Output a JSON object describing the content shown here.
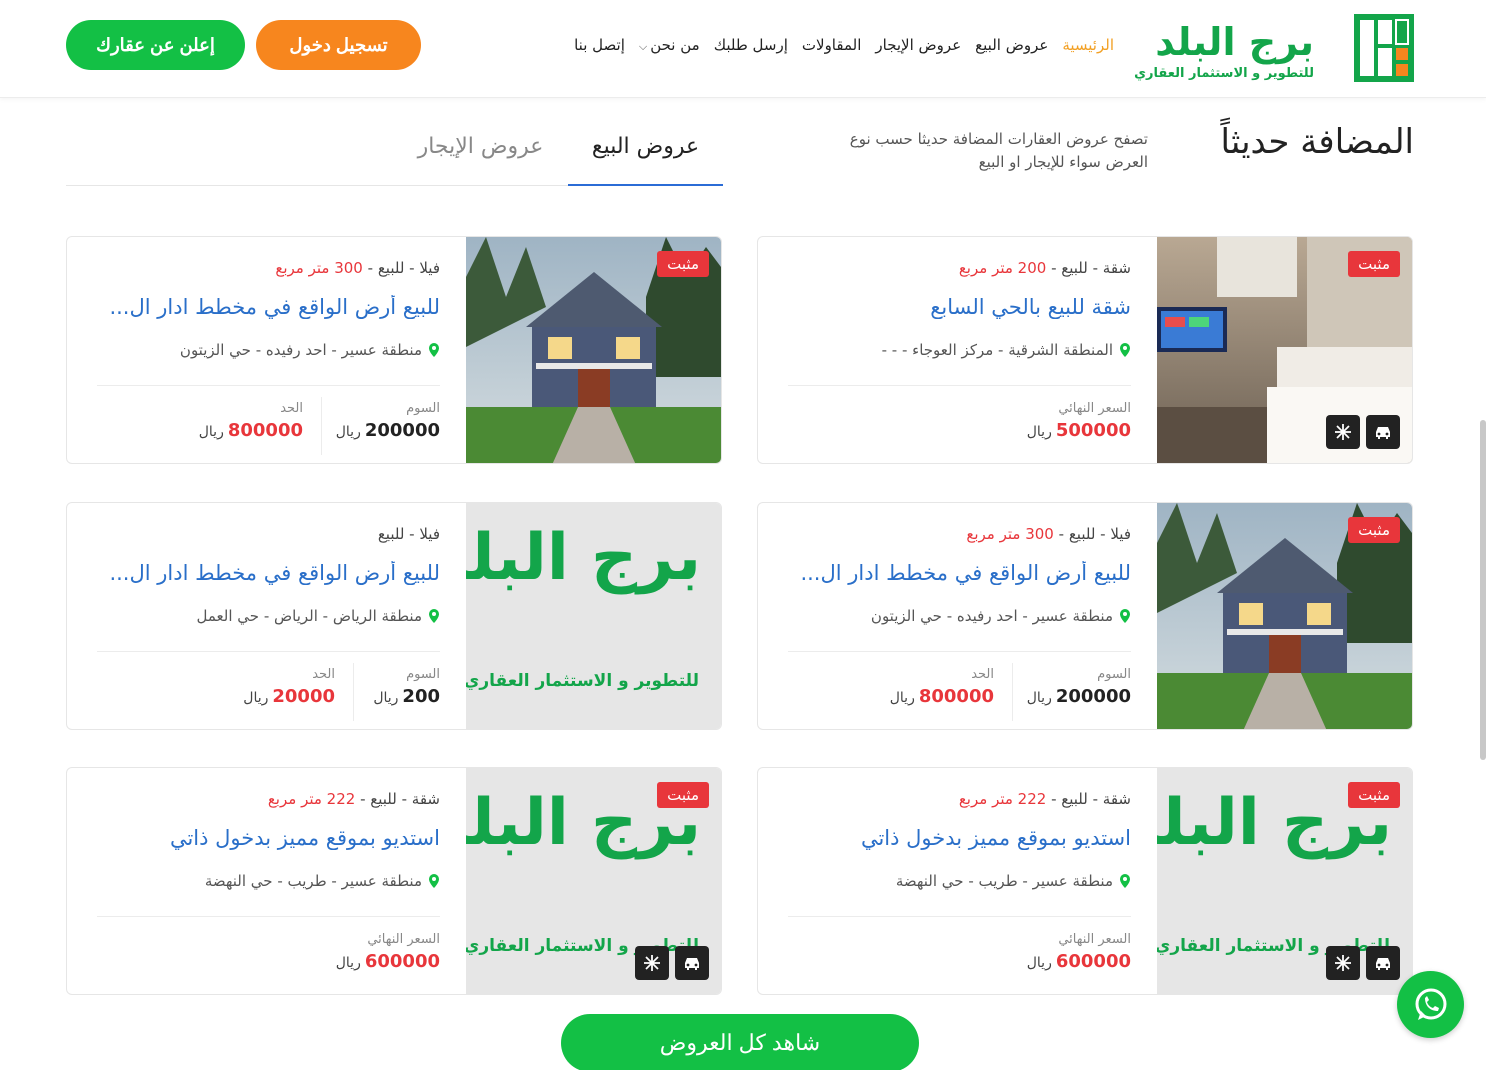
{
  "brand": {
    "name": "برج البلد",
    "tagline": "للتطوير و الاستثمار العقاري",
    "green": "#13a54a",
    "orange": "#f7861e"
  },
  "nav": {
    "items": [
      {
        "label": "الرئيسية",
        "active": true
      },
      {
        "label": "عروض البيع"
      },
      {
        "label": "عروض الإيجار"
      },
      {
        "label": "المقاولات"
      },
      {
        "label": "إرسل طلبك"
      },
      {
        "label": "من نحن"
      },
      {
        "label": "إتصل بنا"
      }
    ],
    "login": "تسجيل دخول",
    "advertise": "إعلن عن عقارك"
  },
  "section": {
    "title": "المضافة حديثاً",
    "description": "تصفح عروض العقارات المضافة حديثا حسب نوع العرض سواء للإيجار او البيع",
    "tabs": {
      "sale": "عروض البيع",
      "rent": "عروض الإيجار"
    }
  },
  "labels": {
    "verified": "مثبت",
    "final_price": "السعر النهائي",
    "bid": "السوم",
    "limit": "الحد",
    "currency": "ريال"
  },
  "cards": [
    {
      "type": "شقة",
      "purpose": "للبيع",
      "area": "200 متر مربع",
      "title": "شقة للبيع بالحي السابع",
      "location": "المنطقة الشرقية - مركز العوجاء - - -",
      "final_price": "500000"
    },
    {
      "type": "فيلا",
      "purpose": "للبيع",
      "area": "300 متر مربع",
      "title": "للبيع أرض الواقع في مخطط ادار ال...",
      "location": "منطقة عسير - احد رفيده - حي الزيتون",
      "bid": "200000",
      "limit": "800000"
    },
    {
      "type": "فيلا",
      "purpose": "للبيع",
      "area": "300 متر مربع",
      "title": "للبيع أرض الواقع في مخطط ادار ال...",
      "location": "منطقة عسير - احد رفيده - حي الزيتون",
      "bid": "200000",
      "limit": "800000"
    },
    {
      "type": "فيلا",
      "purpose": "للبيع",
      "area": "",
      "title": "للبيع أرض الواقع في مخطط ادار ال...",
      "location": "منطقة الرياض - الرياض - حي العمل",
      "bid": "200",
      "limit": "20000"
    },
    {
      "type": "شقة",
      "purpose": "للبيع",
      "area": "222 متر مربع",
      "title": "استديو بموقع مميز بدخول ذاتي",
      "location": "منطقة عسير - طريب - حي النهضة",
      "final_price": "600000"
    },
    {
      "type": "شقة",
      "purpose": "للبيع",
      "area": "222 متر مربع",
      "title": "استديو بموقع مميز بدخول ذاتي",
      "location": "منطقة عسير - طريب - حي النهضة",
      "final_price": "600000"
    }
  ],
  "footer": {
    "view_all": "شاهد كل العروض"
  }
}
